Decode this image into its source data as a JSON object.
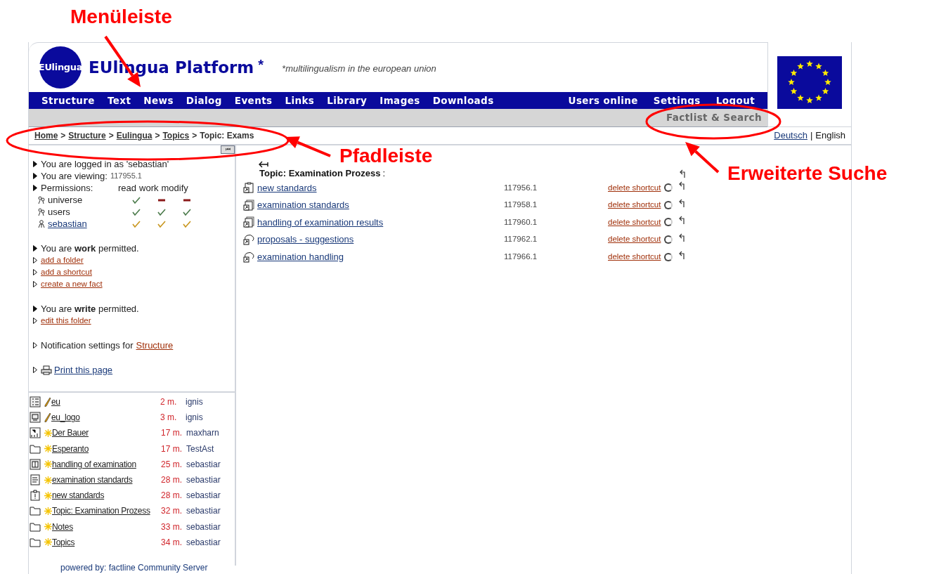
{
  "header": {
    "logo_text": "EUlingua",
    "title": "EUlingua Platform",
    "title_mark": "*",
    "tagline": "*multilingualism in the european union"
  },
  "menu": [
    {
      "label": "Structure"
    },
    {
      "label": "Text"
    },
    {
      "label": "News"
    },
    {
      "label": "Dialog"
    },
    {
      "label": "Events"
    },
    {
      "label": "Links"
    },
    {
      "label": "Library"
    },
    {
      "label": "Images"
    },
    {
      "label": "Downloads"
    }
  ],
  "menu_right": [
    {
      "label": "Users online"
    },
    {
      "label": "Settings"
    },
    {
      "label": "Logout"
    }
  ],
  "search_link": "Factlist & Search",
  "breadcrumb": [
    {
      "label": "Home",
      "link": true
    },
    {
      "label": "Structure",
      "link": true
    },
    {
      "label": "Eulingua",
      "link": true
    },
    {
      "label": "Topics",
      "link": true
    },
    {
      "label": "Topic: Exams",
      "link": false
    }
  ],
  "breadcrumb_separator": ">",
  "languages": [
    {
      "label": "Deutsch",
      "selected": false
    },
    {
      "label": "English",
      "selected": true
    }
  ],
  "language_separator": "|",
  "collapse_button": "⏮",
  "sidebar": {
    "logged_in": "You are logged in as 'sebastian'",
    "viewing_label": "You are viewing:",
    "viewing_id": "117955.1",
    "permissions_label": "Permissions:",
    "permission_columns": [
      "read",
      "work",
      "modify"
    ],
    "permissions": [
      {
        "name": "universe",
        "kind": "group",
        "link": false,
        "granted": [
          true,
          false,
          false
        ]
      },
      {
        "name": "users",
        "kind": "group",
        "link": false,
        "granted": [
          true,
          true,
          true
        ]
      },
      {
        "name": "sebastian",
        "kind": "user",
        "link": true,
        "granted": [
          true,
          true,
          true
        ]
      }
    ],
    "work_text": "You are **work** permitted.",
    "work_links": [
      "add a folder",
      "add a shortcut",
      "create a new fact"
    ],
    "write_text": "You are **write** permitted.",
    "write_links": [
      "edit this folder"
    ],
    "notification_text": "Notification settings for",
    "notification_link": "Structure",
    "print_link": "Print this page"
  },
  "recent": [
    {
      "kind": "list",
      "edited": true,
      "title": "eu",
      "age": "2 m.",
      "user": "ignis"
    },
    {
      "kind": "image",
      "edited": true,
      "title": "eu_logo",
      "age": "3 m.",
      "user": "ignis"
    },
    {
      "kind": "url",
      "edited": false,
      "title": "Der Bauer",
      "age": "17 m.",
      "user": "maxharn"
    },
    {
      "kind": "folder",
      "edited": false,
      "title": "Esperanto",
      "age": "17 m.",
      "user": "TestAst"
    },
    {
      "kind": "book",
      "edited": false,
      "title": "handling of examination",
      "age": "25 m.",
      "user": "sebastiar"
    },
    {
      "kind": "document",
      "edited": false,
      "title": "examination standards",
      "age": "28 m.",
      "user": "sebastiar"
    },
    {
      "kind": "notice",
      "edited": false,
      "title": "new standards",
      "age": "28 m.",
      "user": "sebastiar"
    },
    {
      "kind": "folder",
      "edited": false,
      "title": "Topic: Examination Prozess",
      "age": "32 m.",
      "user": "sebastiar"
    },
    {
      "kind": "folder",
      "edited": false,
      "title": "Notes",
      "age": "33 m.",
      "user": "sebastiar"
    },
    {
      "kind": "folder",
      "edited": false,
      "title": "Topics",
      "age": "34 m.",
      "user": "sebastiar"
    }
  ],
  "content": {
    "heading": "Topic: Examination Prozess",
    "heading_suffix": ":",
    "items": [
      {
        "kind": "clipboard",
        "title": "new standards",
        "id": "117956.1",
        "action": "delete shortcut",
        "selected": false
      },
      {
        "kind": "pages",
        "title": "examination standards",
        "id": "117958.1",
        "action": "delete shortcut",
        "selected": false
      },
      {
        "kind": "pages",
        "title": "handling of examination results",
        "id": "117960.1",
        "action": "delete shortcut",
        "selected": false
      },
      {
        "kind": "bubble",
        "title": "proposals - suggestions",
        "id": "117962.1",
        "action": "delete shortcut",
        "selected": false
      },
      {
        "kind": "bubble",
        "title": "examination handling",
        "id": "117966.1",
        "action": "delete shortcut",
        "selected": false
      }
    ]
  },
  "footer": "powered by: factline Community Server",
  "annotations": [
    {
      "label": "Menüleiste"
    },
    {
      "label": "Pfadleiste"
    },
    {
      "label": "Erweiterte Suche"
    }
  ]
}
